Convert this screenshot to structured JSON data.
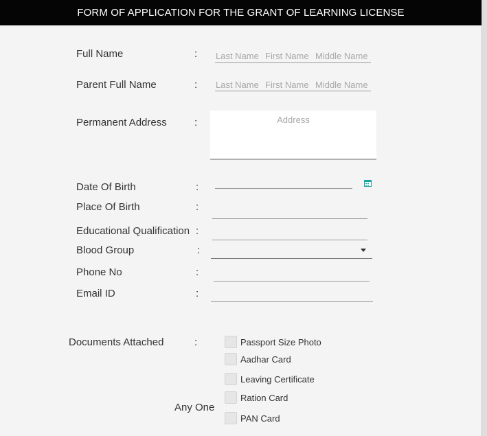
{
  "window": {
    "title": "FORM OF APPLICATION FOR THE GRANT OF LEARNING LICENSE"
  },
  "form": {
    "colon": ":",
    "full_name": {
      "label": "Full Name",
      "last_placeholder": "Last Name",
      "first_placeholder": "First Name",
      "middle_placeholder": "Middle Name"
    },
    "parent_full_name": {
      "label": "Parent Full Name",
      "last_placeholder": "Last Name",
      "first_placeholder": "First Name",
      "middle_placeholder": "Middle Name"
    },
    "permanent_address": {
      "label": "Permanent Address",
      "placeholder": "Address"
    },
    "date_of_birth": {
      "label": "Date Of Birth",
      "value": ""
    },
    "place_of_birth": {
      "label": "Place Of Birth",
      "value": ""
    },
    "educational_qualification": {
      "label": "Educational Qualification",
      "value": ""
    },
    "blood_group": {
      "label": "Blood Group",
      "selected": ""
    },
    "phone_no": {
      "label": "Phone No",
      "value": ""
    },
    "email_id": {
      "label": "Email ID",
      "value": ""
    },
    "documents": {
      "label": "Documents Attached",
      "any_one_label": "Any One",
      "items": [
        {
          "label": "Passport Size Photo",
          "checked": false
        },
        {
          "label": "Aadhar Card",
          "checked": false
        },
        {
          "label": "Leaving Certificate",
          "checked": false
        },
        {
          "label": "Ration Card",
          "checked": false
        },
        {
          "label": "PAN Card",
          "checked": false
        }
      ]
    }
  },
  "colors": {
    "titlebar_bg": "#050505",
    "titlebar_text": "#ffffff",
    "form_bg": "#f4f4f4",
    "accent_icon": "#1aa3a3"
  }
}
